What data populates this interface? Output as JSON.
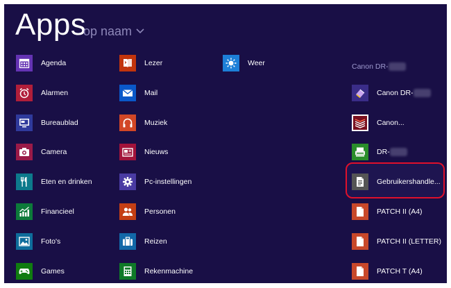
{
  "header": {
    "title": "Apps",
    "sort_label": "op naam"
  },
  "columns": [
    [
      {
        "label": "Agenda",
        "color": "#6433b3",
        "icon": "calendar-icon"
      },
      {
        "label": "Alarmen",
        "color": "#b01e3a",
        "icon": "alarm-clock-icon"
      },
      {
        "label": "Bureaublad",
        "color": "#2f3a9c",
        "icon": "desktop-icon"
      },
      {
        "label": "Camera",
        "color": "#9a1a48",
        "icon": "camera-icon"
      },
      {
        "label": "Eten en drinken",
        "color": "#0d7a8c",
        "icon": "food-drink-icon"
      },
      {
        "label": "Financieel",
        "color": "#0d7a3a",
        "icon": "finance-chart-icon"
      },
      {
        "label": "Foto's",
        "color": "#0e6d9c",
        "icon": "photos-icon"
      },
      {
        "label": "Games",
        "color": "#107c10",
        "icon": "games-controller-icon"
      }
    ],
    [
      {
        "label": "Lezer",
        "color": "#c1340c",
        "icon": "reader-icon"
      },
      {
        "label": "Mail",
        "color": "#0a58c9",
        "icon": "mail-icon"
      },
      {
        "label": "Muziek",
        "color": "#d24726",
        "icon": "music-headphones-icon"
      },
      {
        "label": "Nieuws",
        "color": "#a2133b",
        "icon": "news-icon"
      },
      {
        "label": "Pc-instellingen",
        "color": "#4a3ba3",
        "icon": "settings-gear-icon"
      },
      {
        "label": "Personen",
        "color": "#c43f14",
        "icon": "people-icon"
      },
      {
        "label": "Reizen",
        "color": "#1268a8",
        "icon": "travel-suitcase-icon"
      },
      {
        "label": "Rekenmachine",
        "color": "#0f7a28",
        "icon": "calculator-icon"
      }
    ],
    [
      {
        "label": "Weer",
        "color": "#1d7fd8",
        "icon": "weather-sun-icon"
      }
    ]
  ],
  "group": {
    "header": "Canon DR-",
    "items": [
      {
        "label": "Canon DR-",
        "redacted": true,
        "color": "#3a2d88",
        "icon": "canon-scanner-pen-icon"
      },
      {
        "label": "Canon...",
        "redacted": false,
        "color": "#ffffff",
        "icon": "canon-document-stack-icon"
      },
      {
        "label": "DR-",
        "redacted": true,
        "color": "#2a8d2a",
        "icon": "scanner-icon"
      },
      {
        "label": "Gebruikershandle...",
        "redacted": false,
        "color": "#555555",
        "icon": "document-icon",
        "highlighted": true
      },
      {
        "label": "PATCH II (A4)",
        "redacted": false,
        "color": "#c8482a",
        "icon": "pdf-document-icon"
      },
      {
        "label": "PATCH II (LETTER)",
        "redacted": false,
        "color": "#c8482a",
        "icon": "pdf-document-icon"
      },
      {
        "label": "PATCH T (A4)",
        "redacted": false,
        "color": "#c8482a",
        "icon": "pdf-document-icon"
      }
    ]
  }
}
